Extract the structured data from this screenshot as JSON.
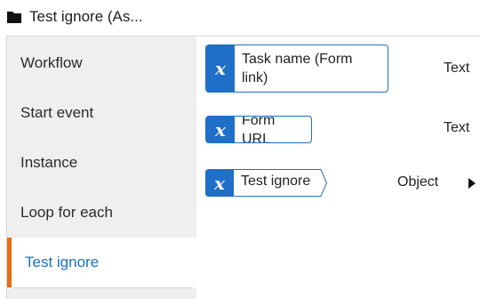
{
  "header": {
    "icon": "folder-icon",
    "title": "Test ignore (As..."
  },
  "sidebar": {
    "items": [
      {
        "label": "Workflow"
      },
      {
        "label": "Start event"
      },
      {
        "label": "Instance"
      },
      {
        "label": "Loop for each"
      },
      {
        "label": "Test ignore",
        "active": true
      }
    ]
  },
  "variables": [
    {
      "glyph": "x",
      "name": "Task name (Form link)",
      "type": "Text"
    },
    {
      "glyph": "x",
      "name": "Form URL",
      "type": "Text"
    },
    {
      "glyph": "x",
      "name": "Test ignore",
      "type": "Object",
      "expandable": true
    }
  ],
  "colors": {
    "accent": "#1f6fc8",
    "active_indicator": "#ea6b12",
    "active_text": "#1a6fc4",
    "sidebar_bg": "#efefef"
  }
}
